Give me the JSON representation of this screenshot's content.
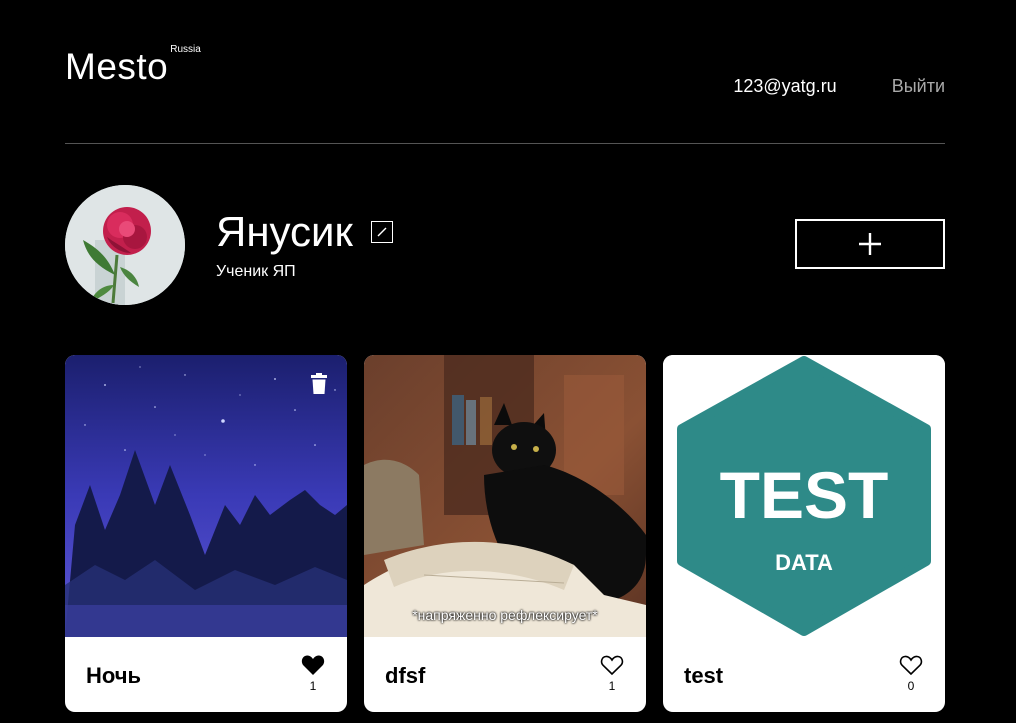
{
  "header": {
    "logo_text": "Mesto",
    "logo_superscript": "Russia",
    "user_email": "123@yatg.ru",
    "logout_label": "Выйти"
  },
  "profile": {
    "name": "Янусик",
    "about": "Ученик ЯП",
    "avatar_icon": "peony-avatar-image",
    "edit_icon": "pencil-icon",
    "add_icon": "plus-icon"
  },
  "cards": [
    {
      "title": "Ночь",
      "likes": "1",
      "liked": true,
      "deletable": true,
      "image": "night-forest-image",
      "caption": ""
    },
    {
      "title": "dfsf",
      "likes": "1",
      "liked": false,
      "deletable": false,
      "image": "black-cat-book-image",
      "caption": "*напряженно рефлексирует*"
    },
    {
      "title": "test",
      "likes": "0",
      "liked": false,
      "deletable": false,
      "image": "test-data-badge-image",
      "caption": ""
    }
  ],
  "test_badge": {
    "line1": "TEST",
    "line2": "DATA",
    "color": "#2e8a88"
  },
  "colors": {
    "background": "#000000",
    "card_bg": "#ffffff",
    "divider": "#545454",
    "logout": "#a9a9a9"
  }
}
